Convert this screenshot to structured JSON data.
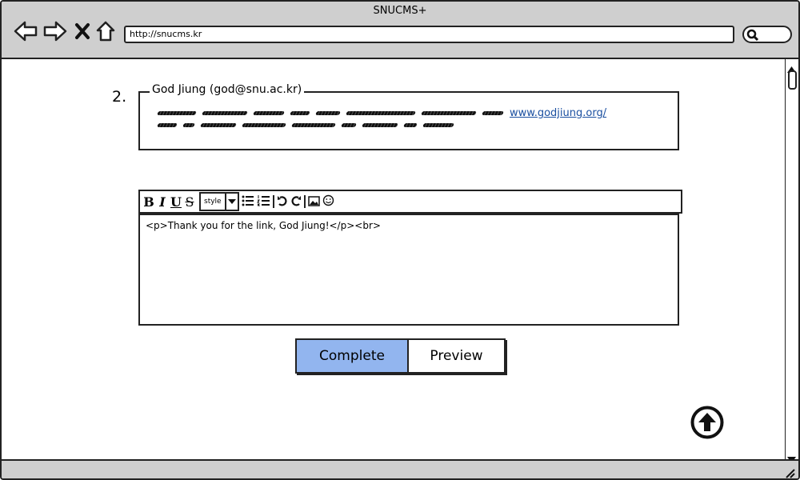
{
  "window": {
    "title": "SNUCMS+"
  },
  "browser": {
    "url": "http://snucms.kr"
  },
  "comment": {
    "number": "2.",
    "author": "God Jiung (god@snu.ac.kr)",
    "link": "www.godjiung.org/"
  },
  "editor": {
    "style_label": "style",
    "content": "<p>Thank you for the link, God Jiung!</p><br>"
  },
  "actions": {
    "complete": "Complete",
    "preview": "Preview"
  },
  "colors": {
    "primary": "#92b5ef",
    "chrome": "#cfcfcf",
    "link": "#1a4fa0"
  },
  "icons": [
    "back-icon",
    "forward-icon",
    "stop-icon",
    "home-icon",
    "search-icon",
    "bold-icon",
    "italic-icon",
    "underline-icon",
    "strikethrough-icon",
    "bullet-list-icon",
    "numbered-list-icon",
    "undo-icon",
    "redo-icon",
    "image-icon",
    "emoji-icon",
    "scroll-up-icon"
  ]
}
